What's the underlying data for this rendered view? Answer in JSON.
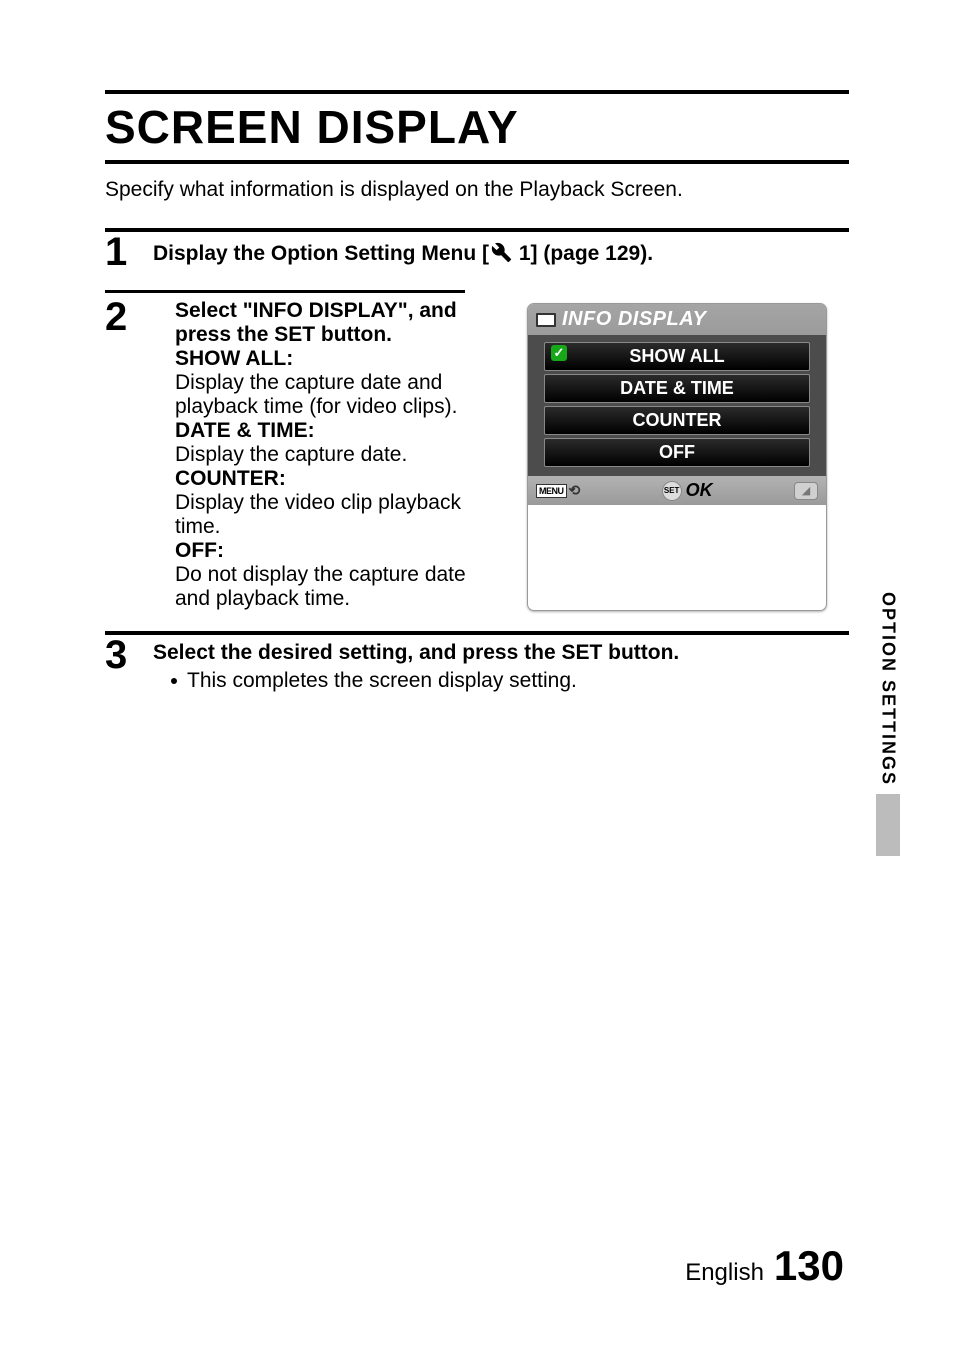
{
  "title": "SCREEN DISPLAY",
  "intro": "Specify what information is displayed on the Playback Screen.",
  "steps": {
    "1": {
      "text_a": "Display the Option Setting Menu [",
      "text_b": " 1] (page 129)."
    },
    "2": {
      "heading": "Select \"INFO DISPLAY\", and press the SET button.",
      "options": {
        "show_all": {
          "label": "SHOW ALL:",
          "text": "Display the capture date and playback time (for video clips)."
        },
        "date_time": {
          "label": "DATE & TIME:",
          "text": "Display the capture date."
        },
        "counter": {
          "label": "COUNTER:",
          "text": "Display the video clip playback time."
        },
        "off": {
          "label": "OFF:",
          "text": "Do not display the capture date and playback time."
        }
      }
    },
    "3": {
      "heading": "Select the desired setting, and press the SET button.",
      "bullet": "This completes the screen display setting."
    }
  },
  "lcd": {
    "title": "INFO DISPLAY",
    "rows": [
      "SHOW ALL",
      "DATE & TIME",
      "COUNTER",
      "OFF"
    ],
    "menu": "MENU",
    "set": "SET",
    "ok": "OK"
  },
  "side_tab": "OPTION SETTINGS",
  "footer": {
    "lang": "English",
    "page": "130"
  }
}
